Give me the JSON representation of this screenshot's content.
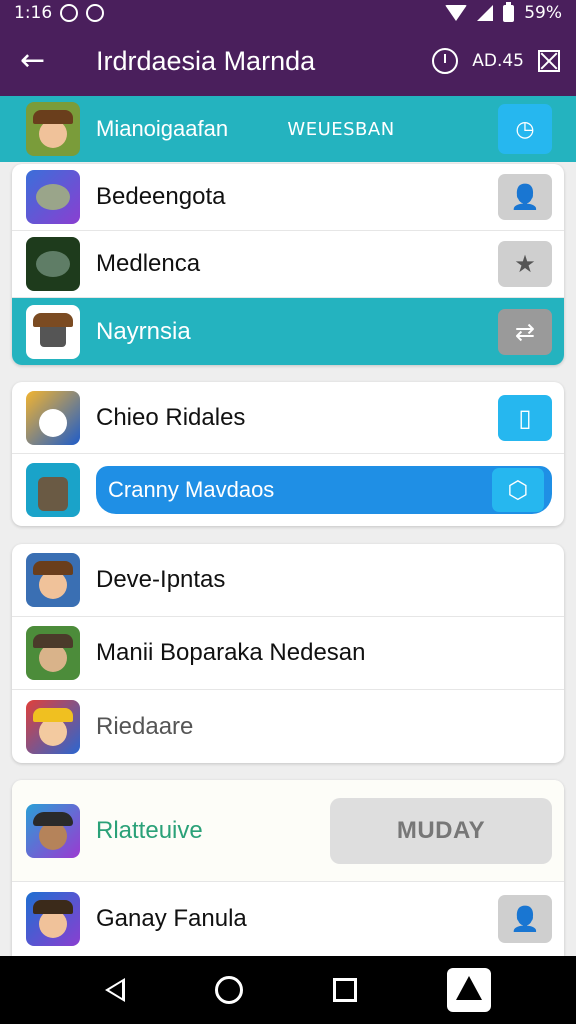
{
  "status_bar": {
    "time": "1:16",
    "battery": "59%"
  },
  "app_bar": {
    "title": "Irdrdaesia Marnda",
    "meta": "AD.45"
  },
  "header": {
    "label": "Mianoigaafan",
    "meta": "WEUESBAN"
  },
  "group1": [
    {
      "label": "Bedeengota",
      "button_icon": "person-icon"
    },
    {
      "label": "Medlenca",
      "button_icon": "star-icon"
    },
    {
      "label": "Nayrnsia",
      "button_icon": "share-icon"
    }
  ],
  "group2": [
    {
      "label": "Chieo Ridales",
      "button_icon": "square-icon"
    },
    {
      "label": "Cranny Mavdaos",
      "button_icon": "shield-icon"
    }
  ],
  "group3": [
    {
      "label": "Deve-Ipntas"
    },
    {
      "label": "Manii Boparaka Nedesan"
    },
    {
      "label": "Riedaare"
    }
  ],
  "group4": [
    {
      "label": "Rlatteuive",
      "button_label": "MUDAY"
    },
    {
      "label": "Ganay Fanula",
      "button_icon": "person-icon"
    }
  ],
  "colors": {
    "primary": "#4a1f5c",
    "accent": "#24b3bf",
    "blue": "#26b7ef"
  }
}
